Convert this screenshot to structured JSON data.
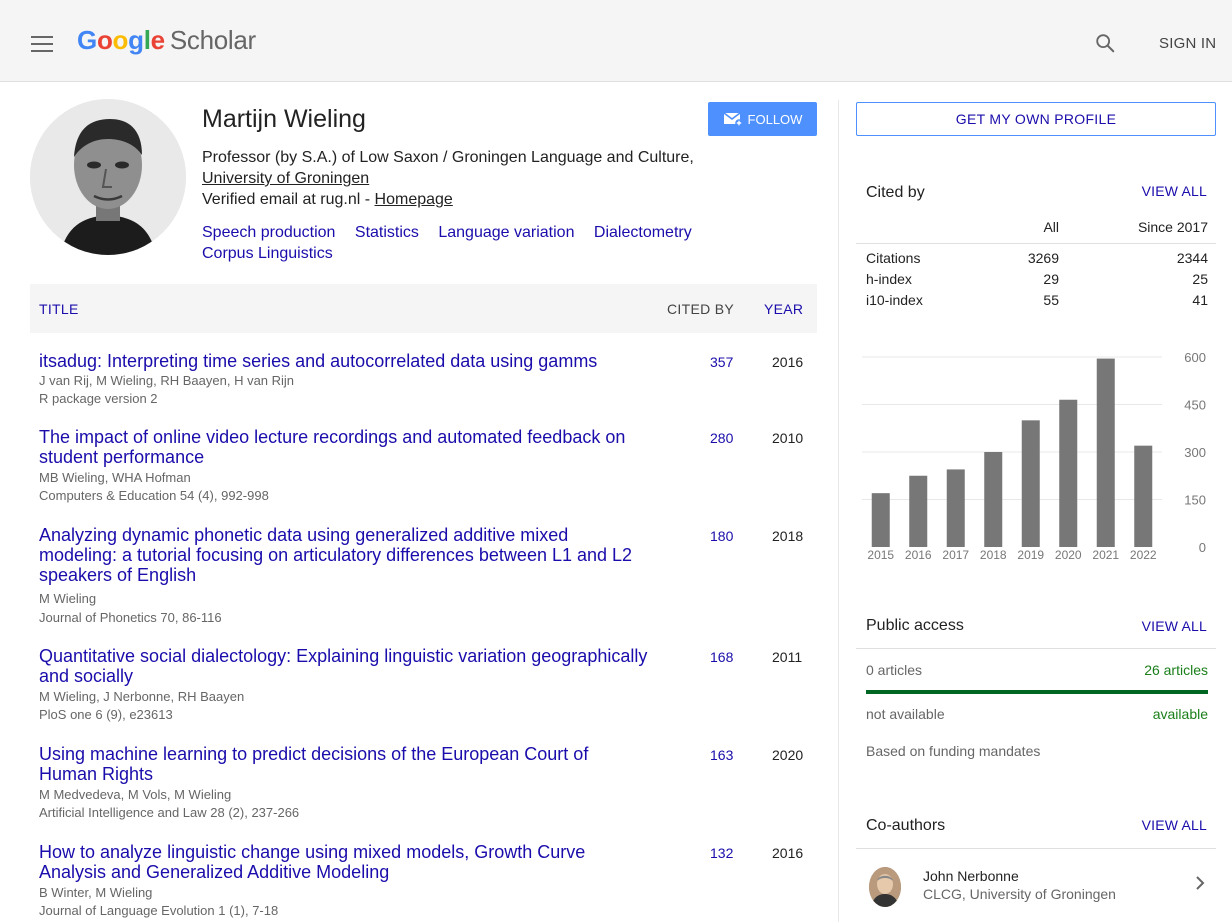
{
  "header": {
    "logo_google": "Google",
    "logo_scholar": "Scholar",
    "signin": "SIGN IN"
  },
  "profile": {
    "name": "Martijn Wieling",
    "affiliation_prefix": "Professor (by S.A.) of Low Saxon / Groningen Language and Culture, ",
    "affiliation_link": "University of Groningen",
    "email_prefix": "Verified email at rug.nl - ",
    "homepage": "Homepage",
    "follow": "FOLLOW",
    "interests": [
      "Speech production",
      "Statistics",
      "Language variation",
      "Dialectometry",
      "Corpus Linguistics"
    ]
  },
  "table": {
    "col_title": "TITLE",
    "col_cited": "CITED BY",
    "col_year": "YEAR",
    "articles": [
      {
        "title": "itsadug: Interpreting time series and autocorrelated data using gamms",
        "authors": "J van Rij, M Wieling, RH Baayen, H van Rijn",
        "venue": "R package version 2",
        "cited": "357",
        "year": "2016"
      },
      {
        "title": "The impact of online video lecture recordings and automated feedback on student performance",
        "authors": "MB Wieling, WHA Hofman",
        "venue": "Computers & Education 54 (4), 992-998",
        "cited": "280",
        "year": "2010"
      },
      {
        "title": "Analyzing dynamic phonetic data using generalized additive mixed modeling: a tutorial focusing on articulatory differences between L1 and L2 speakers of English",
        "authors": "M Wieling",
        "venue": "Journal of Phonetics 70, 86-116",
        "cited": "180",
        "year": "2018"
      },
      {
        "title": "Quantitative social dialectology: Explaining linguistic variation geographically and socially",
        "authors": "M Wieling, J Nerbonne, RH Baayen",
        "venue": "PloS one 6 (9), e23613",
        "cited": "168",
        "year": "2011"
      },
      {
        "title": "Using machine learning to predict decisions of the European Court of Human Rights",
        "authors": "M Medvedeva, M Vols, M Wieling",
        "venue": "Artificial Intelligence and Law 28 (2), 237-266",
        "cited": "163",
        "year": "2020"
      },
      {
        "title": "How to analyze linguistic change using mixed models, Growth Curve Analysis and Generalized Additive Modeling",
        "authors": "B Winter, M Wieling",
        "venue": "Journal of Language Evolution 1 (1), 7-18",
        "cited": "132",
        "year": "2016"
      }
    ]
  },
  "sidebar": {
    "own_profile": "GET MY OWN PROFILE",
    "cited_by": {
      "title": "Cited by",
      "view_all": "VIEW ALL",
      "col_all": "All",
      "col_since": "Since 2017",
      "rows": [
        {
          "label": "Citations",
          "all": "3269",
          "since": "2344"
        },
        {
          "label": "h-index",
          "all": "29",
          "since": "25"
        },
        {
          "label": "i10-index",
          "all": "55",
          "since": "41"
        }
      ]
    },
    "public_access": {
      "title": "Public access",
      "view_all": "VIEW ALL",
      "left_count": "0 articles",
      "right_count": "26 articles",
      "left_label": "not available",
      "right_label": "available",
      "note": "Based on funding mandates",
      "available_fraction": 1.0
    },
    "coauthors": {
      "title": "Co-authors",
      "view_all": "VIEW ALL",
      "items": [
        {
          "name": "John Nerbonne",
          "affiliation": "CLCG, University of Groningen"
        }
      ]
    }
  },
  "chart_data": {
    "type": "bar",
    "categories": [
      "2015",
      "2016",
      "2017",
      "2018",
      "2019",
      "2020",
      "2021",
      "2022"
    ],
    "values": [
      170,
      225,
      245,
      300,
      400,
      465,
      595,
      320
    ],
    "yticks": [
      "600",
      "450",
      "300",
      "150",
      "0"
    ],
    "ylim": [
      0,
      600
    ],
    "bar_color": "#777777"
  }
}
